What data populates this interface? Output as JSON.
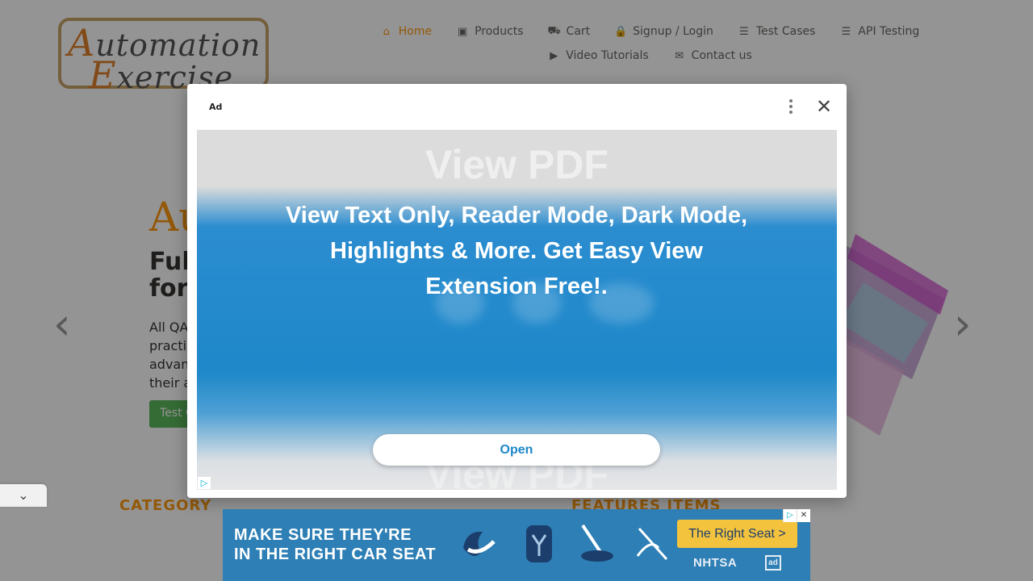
{
  "logo": {
    "line1_cap": "A",
    "line1_rest": "utomation",
    "line2_cap": "E",
    "line2_rest": "xercise"
  },
  "nav": {
    "row1": [
      {
        "label": "Home",
        "icon": "home-icon",
        "glyph": "⌂",
        "active": true
      },
      {
        "label": "Products",
        "icon": "briefcase-icon",
        "glyph": "▣"
      },
      {
        "label": "Cart",
        "icon": "cart-icon",
        "glyph": "⛟"
      },
      {
        "label": "Signup / Login",
        "icon": "lock-icon",
        "glyph": "🔒"
      },
      {
        "label": "Test Cases",
        "icon": "list-icon",
        "glyph": "☰"
      },
      {
        "label": "API Testing",
        "icon": "list-icon",
        "glyph": "☰"
      }
    ],
    "row2": [
      {
        "label": "Video Tutorials",
        "icon": "youtube-icon",
        "glyph": "▶"
      },
      {
        "label": "Contact us",
        "icon": "envelope-icon",
        "glyph": "✉"
      }
    ]
  },
  "hero": {
    "title": "Au",
    "subtitle_l1": "Ful",
    "subtitle_l2": "for",
    "text_l1": "All QA",
    "text_l2": "practi",
    "text_l3": "advan",
    "text_l4": "their a",
    "button": "Test C"
  },
  "sections": {
    "category": "CATEGORY",
    "features": "FEATURES ITEMS"
  },
  "modal": {
    "ad_label": "Ad",
    "ghost_title": "View PDF",
    "headline": "View Text Only, Reader Mode, Dark Mode, Highlights & More. Get Easy View Extension Free!.",
    "open_label": "Open"
  },
  "banner": {
    "line1": "MAKE SURE THEY'RE",
    "line2": "IN THE RIGHT CAR SEAT",
    "cta": "The Right Seat >",
    "agency": "NHTSA",
    "council": "ad"
  },
  "colors": {
    "accent": "#FE980F",
    "ad_blue": "#1e88c9",
    "banner_blue": "#2d7fb5",
    "cta_yellow": "#f4c33d"
  }
}
